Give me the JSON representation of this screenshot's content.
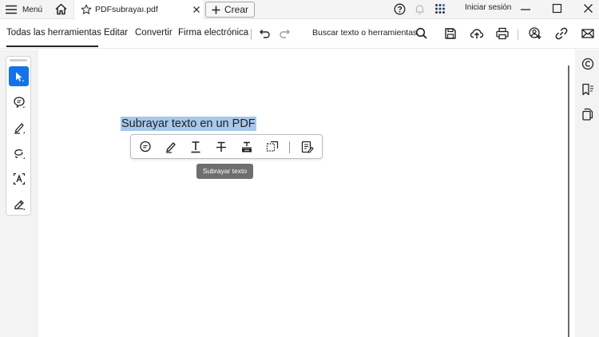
{
  "titlebar": {
    "menu_label": "Menú",
    "tab_title": "PDFsubrayaı.pdf",
    "create_label": "Crear",
    "signin_label": "Iniciar sesión"
  },
  "toolbar": {
    "all_tools": "Todas las herramientas",
    "edit": "Editar",
    "convert": "Convertir",
    "esign": "Firma electrónica",
    "search_placeholder": "Buscar texto o herramientas"
  },
  "document": {
    "selected_text": "Subrayar texto en un PDF"
  },
  "quick_actions": {
    "tooltip": "Subrayar texto"
  },
  "colors": {
    "accent": "#1473e6",
    "selection": "#a6c8ea",
    "tooltip_bg": "#6e6e6e"
  },
  "icons": {
    "left_tools": [
      "select-arrow-icon",
      "comment-icon",
      "highlight-pen-icon",
      "lasso-draw-icon",
      "text-box-icon",
      "sign-pen-icon"
    ],
    "quick_actions": [
      "comment-icon",
      "highlight-icon",
      "underline-icon",
      "strikethrough-icon",
      "replace-text-icon",
      "text-box-select-icon",
      "more-annotations-icon"
    ],
    "right_panel": [
      "comments-panel-icon",
      "bookmarks-icon",
      "copy-pages-icon"
    ]
  }
}
